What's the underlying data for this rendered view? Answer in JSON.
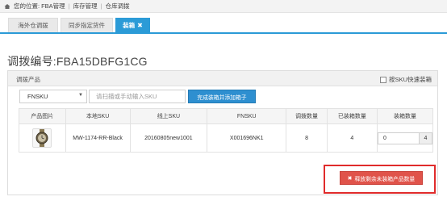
{
  "breadcrumb": {
    "prefix": "您的位置:",
    "items": [
      "FBA管理",
      "库存管理",
      "仓库调拨"
    ]
  },
  "tabs": [
    {
      "label": "海外仓调拨"
    },
    {
      "label": "同步指定货件"
    },
    {
      "label": "装箱"
    }
  ],
  "page_title": "调拨编号:FBA15DBFG1CG",
  "panel": {
    "title": "调拨产品",
    "quick_pack_label": "按SKU快速装箱"
  },
  "search": {
    "select_value": "FNSKU",
    "input_placeholder": "请扫描或手动输入SKU",
    "add_button_label": "完成装箱并添加箱子"
  },
  "table": {
    "headers": [
      "产品图片",
      "本地SKU",
      "线上SKU",
      "FNSKU",
      "调拨数量",
      "已装箱数量",
      "装箱数量"
    ],
    "rows": [
      {
        "local_sku": "MW-1174-RR-Black",
        "online_sku": "20160805new1001",
        "fnsku": "X001696NK1",
        "transfer_qty": "8",
        "packed_qty": "4",
        "pack_qty_value": "0",
        "pack_qty_addon": "4"
      }
    ]
  },
  "release_button_label": "释放剩余未装箱产品数量",
  "colors": {
    "tab_active": "#2b9bd7",
    "primary_button": "#2e8fd0",
    "danger_button": "#e0534a",
    "highlight": "#e02b2b"
  },
  "icons": {
    "home": "home-icon",
    "select_caret": "caret-down-icon",
    "tab_close": "close-icon",
    "release": "close-icon",
    "product": "watch-icon"
  }
}
